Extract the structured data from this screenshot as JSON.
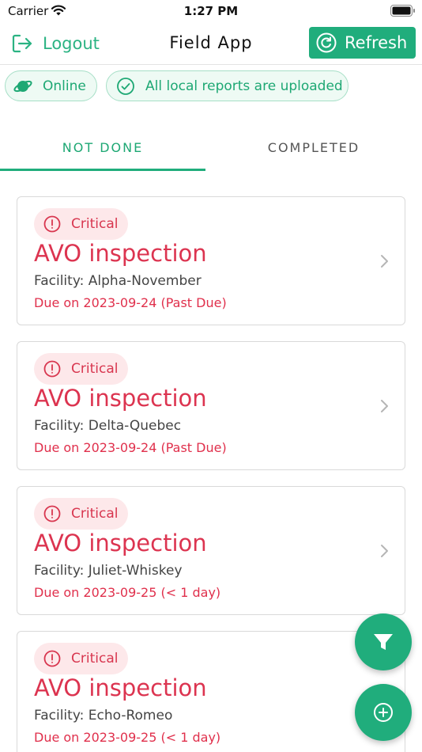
{
  "status_bar": {
    "carrier": "Carrier",
    "time": "1:27 PM"
  },
  "header": {
    "logout_label": "Logout",
    "title": "Field App",
    "refresh_label": "Refresh"
  },
  "status_chips": {
    "online_label": "Online",
    "upload_label": "All local reports are uploaded"
  },
  "tabs": [
    {
      "label": "NOT DONE",
      "active": true
    },
    {
      "label": "COMPLETED",
      "active": false
    }
  ],
  "reports": [
    {
      "severity": "Critical",
      "title": "AVO inspection",
      "facility": "Facility: Alpha-November",
      "due": "Due on 2023-09-24 (Past Due)"
    },
    {
      "severity": "Critical",
      "title": "AVO inspection",
      "facility": "Facility: Delta-Quebec",
      "due": "Due on 2023-09-24 (Past Due)"
    },
    {
      "severity": "Critical",
      "title": "AVO inspection",
      "facility": "Facility: Juliet-Whiskey",
      "due": "Due on 2023-09-25 (< 1 day)"
    },
    {
      "severity": "Critical",
      "title": "AVO inspection",
      "facility": "Facility: Echo-Romeo",
      "due": "Due on 2023-09-25 (< 1 day)"
    }
  ],
  "icons": {
    "logout": "logout-icon",
    "refresh": "refresh-icon",
    "online": "planet-icon",
    "upload": "check-circle-icon",
    "severity": "alert-circle-icon",
    "row": "chevron-right-icon",
    "filter": "filter-icon",
    "add": "plus-circle-icon"
  },
  "colors": {
    "accent": "#20ad7c",
    "critical": "#dc3450",
    "critical_bg": "#fde8ea",
    "chip_bg": "#eefaf4"
  }
}
